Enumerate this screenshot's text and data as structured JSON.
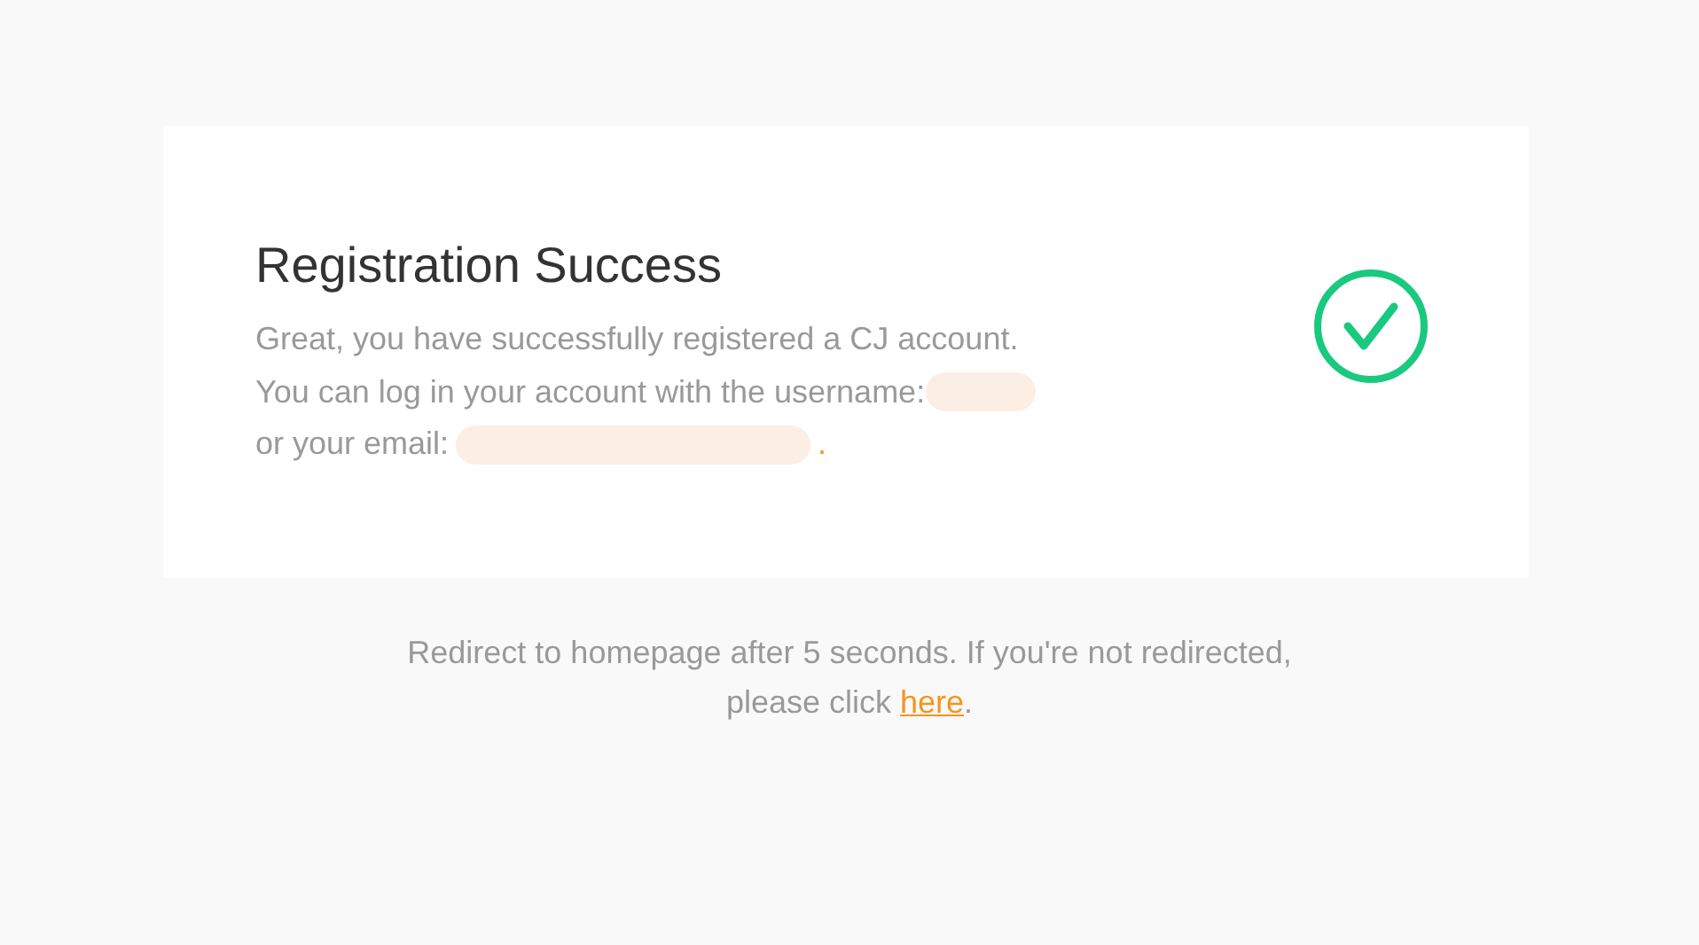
{
  "card": {
    "title": "Registration Success",
    "lines": [
      {
        "text": "Great, you have successfully registered a CJ account."
      },
      {
        "text": "You can log in your account with the username:",
        "redacted": true
      },
      {
        "text": "or your email:",
        "redacted": true,
        "suffix": "."
      }
    ]
  },
  "footer": {
    "text": "Redirect to homepage after 5 seconds. If you're not redirected,",
    "prefix": "please click",
    "link": "here",
    "suffix": "."
  }
}
